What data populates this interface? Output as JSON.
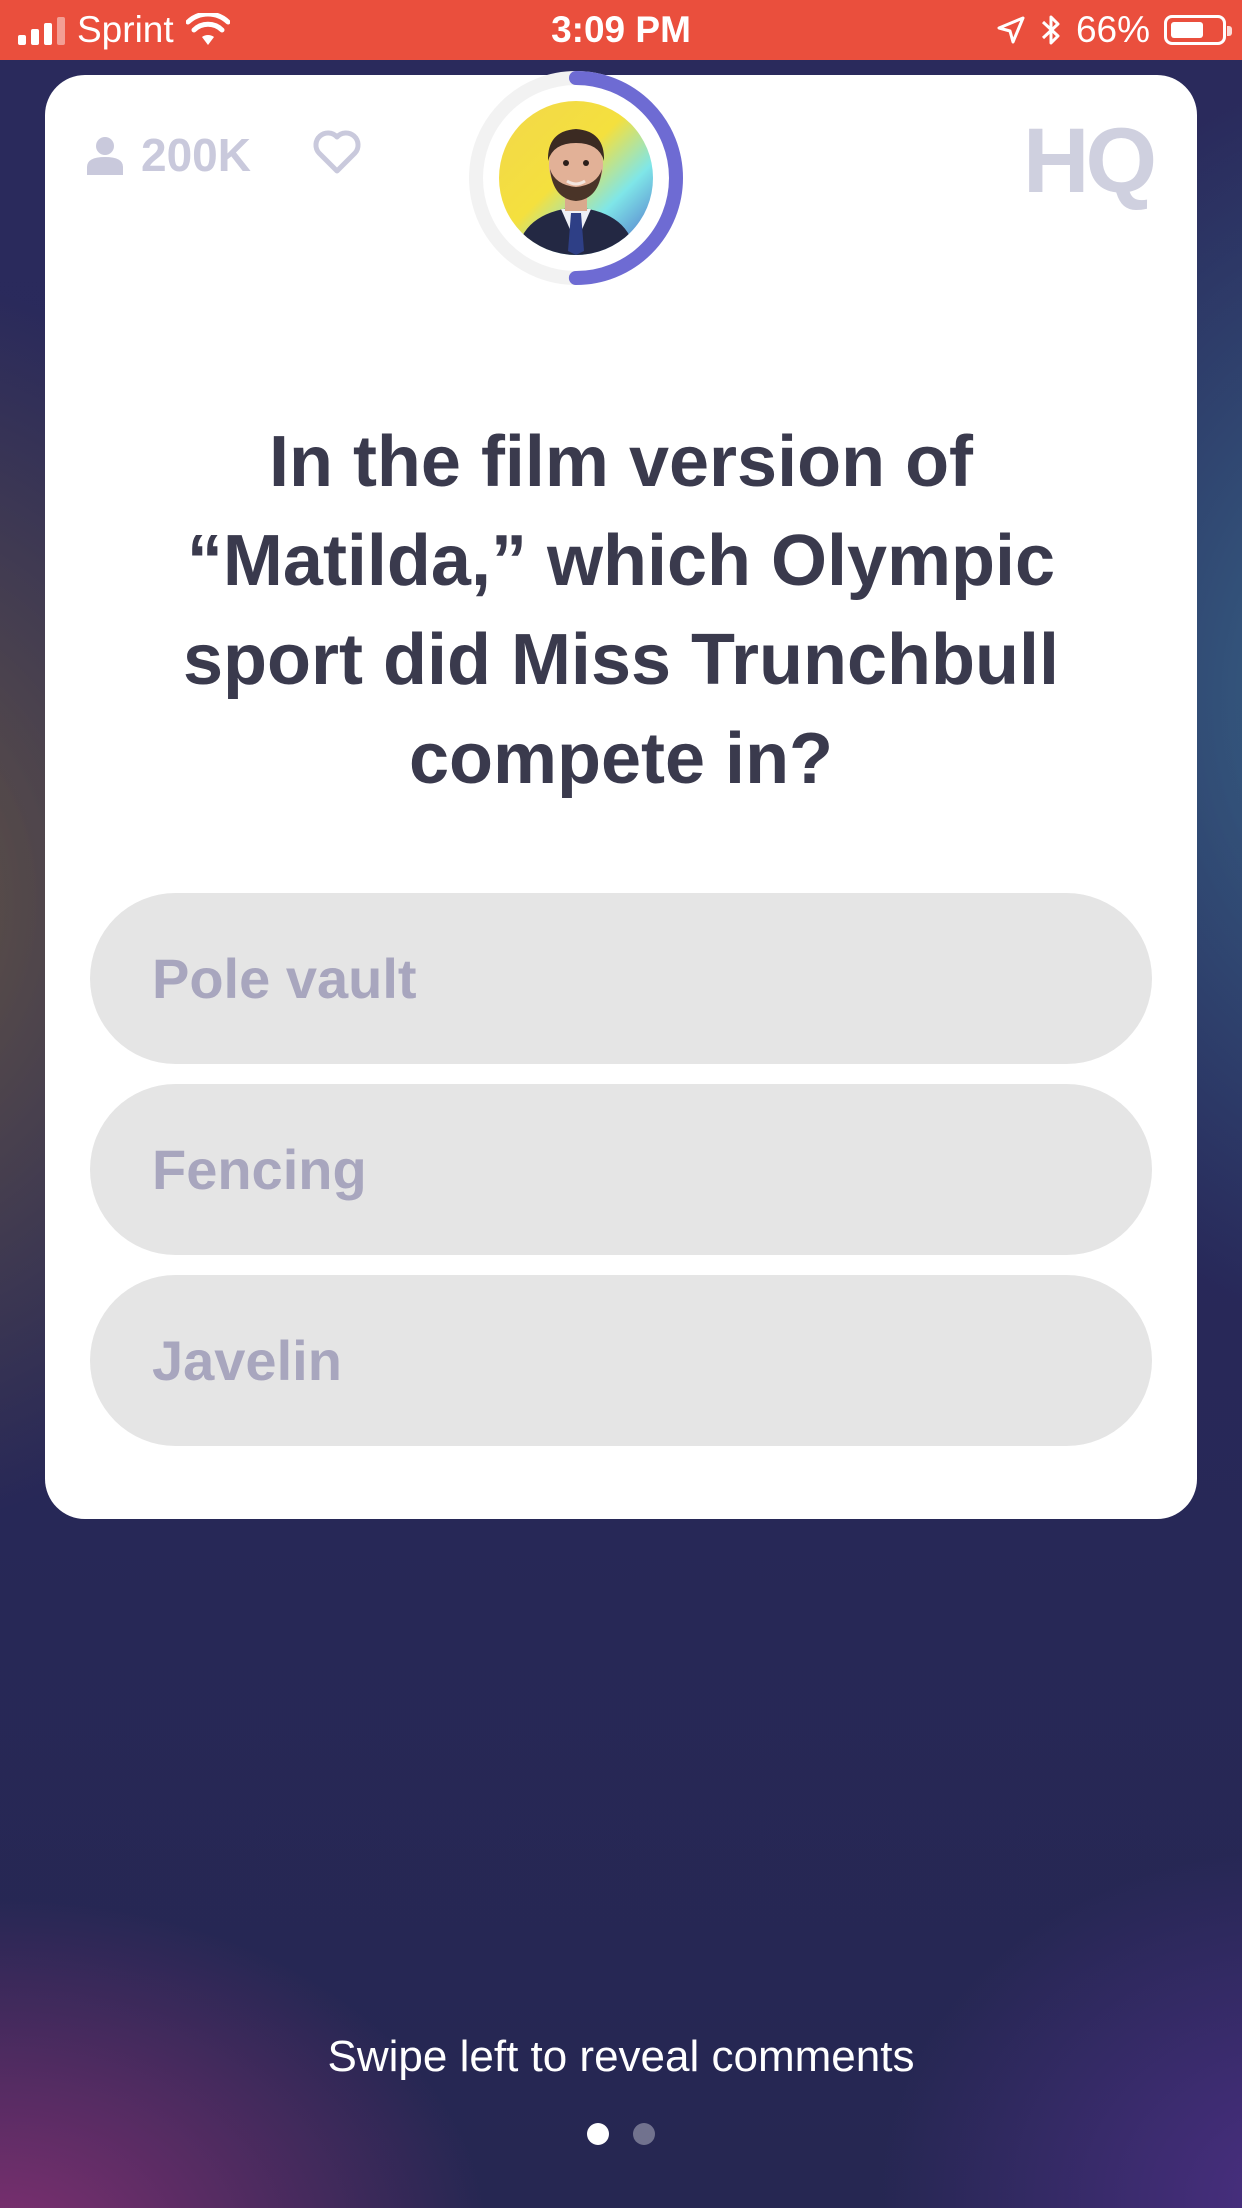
{
  "status_bar": {
    "carrier": "Sprint",
    "time": "3:09 PM",
    "battery_percent": "66%",
    "battery_level": 0.66,
    "icons": [
      "signal-icon",
      "wifi-icon",
      "location-icon",
      "bluetooth-icon",
      "battery-icon"
    ]
  },
  "card": {
    "viewer_count": "200K",
    "logo": "HQ",
    "timer_progress": 0.5,
    "question": "In the film version of “Matilda,” which Olympic sport did Miss Trunchbull compete in?",
    "answers": [
      {
        "label": "Pole vault"
      },
      {
        "label": "Fencing"
      },
      {
        "label": "Javelin"
      }
    ]
  },
  "footer": {
    "swipe_hint": "Swipe left to reveal comments",
    "page_count": 2,
    "active_page": 0
  },
  "colors": {
    "status_bar": "#ea4f3d",
    "timer_arc": "#6e6bd3",
    "question_text": "#3a3a4d",
    "answer_bg": "#e5e5e5",
    "answer_text": "#a8a6be"
  }
}
